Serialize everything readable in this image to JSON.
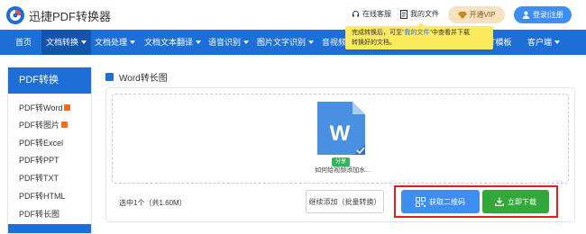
{
  "app": {
    "title": "迅捷PDF转换器"
  },
  "header": {
    "online_service": "在线客服",
    "my_files": "我的文件",
    "vip": "开通VIP",
    "login": "登录|注册"
  },
  "nav": {
    "items": [
      {
        "label": "首页",
        "active": false,
        "dropdown": false
      },
      {
        "label": "文档转换",
        "active": true,
        "dropdown": true
      },
      {
        "label": "文档处理",
        "active": false,
        "dropdown": true
      },
      {
        "label": "文档文本翻译",
        "active": false,
        "dropdown": true
      },
      {
        "label": "语音识别",
        "active": false,
        "dropdown": true
      },
      {
        "label": "图片文字识别",
        "active": false,
        "dropdown": true
      },
      {
        "label": "音视频",
        "active": false,
        "dropdown": false
      },
      {
        "label": "T模板",
        "active": false,
        "dropdown": false
      },
      {
        "label": "客户端",
        "active": false,
        "dropdown": true
      }
    ]
  },
  "tooltip": {
    "part1": "完成转换后，可至",
    "highlight": "\"我的文件\"",
    "part2": "中查看并下载",
    "line2": "转换好的文档。"
  },
  "sidebar": {
    "title": "PDF转换",
    "items": [
      {
        "label": "PDF转Word",
        "hot": true
      },
      {
        "label": "PDF转图片",
        "hot": true
      },
      {
        "label": "PDF转Excel",
        "hot": false
      },
      {
        "label": "PDF转PPT",
        "hot": false
      },
      {
        "label": "PDF转TXT",
        "hot": false
      },
      {
        "label": "PDF转HTML",
        "hot": false
      },
      {
        "label": "PDF转长图",
        "hot": false
      }
    ]
  },
  "main": {
    "title": "Word转长图",
    "file": {
      "icon": "word-file-icon",
      "letter": "W",
      "share_label": "分享",
      "name": "如何给视频添加水..."
    },
    "selection_info": "选中1个（共1.60M）",
    "add_button": "继续添加（批量转换）",
    "qr_button": "获取二维码",
    "download_button": "立即下载"
  },
  "colors": {
    "nav_bg": "#1e6ed8",
    "nav_active": "#1554ab",
    "tooltip_bg": "#fde95c",
    "qr_button": "#3d8ef0",
    "download_button": "#32a83b",
    "highlight_frame": "#e81c1c",
    "vip_bg": "#f6e1c0"
  }
}
